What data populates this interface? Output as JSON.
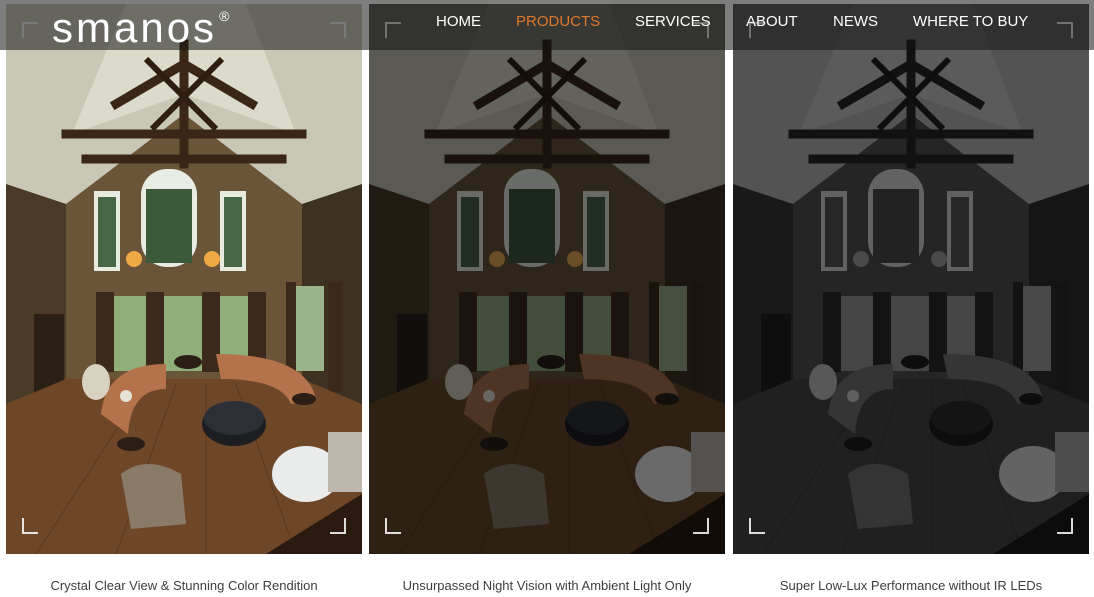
{
  "brand": {
    "name": "smanos",
    "mark": "®"
  },
  "nav": {
    "items": [
      {
        "label": "HOME",
        "active": false
      },
      {
        "label": "PRODUCTS",
        "active": true
      },
      {
        "label": "SERVICES",
        "active": false
      },
      {
        "label": "ABOUT",
        "active": false
      },
      {
        "label": "NEWS",
        "active": false
      },
      {
        "label": "WHERE TO BUY",
        "active": false
      }
    ],
    "active_color": "#e0782c"
  },
  "panels": [
    {
      "caption": "Crystal Clear View & Stunning Color Rendition",
      "mode": "color"
    },
    {
      "caption": "Unsurpassed Night Vision with Ambient Light Only",
      "mode": "night"
    },
    {
      "caption": "Super Low-Lux Performance without IR LEDs",
      "mode": "low-lux"
    }
  ]
}
